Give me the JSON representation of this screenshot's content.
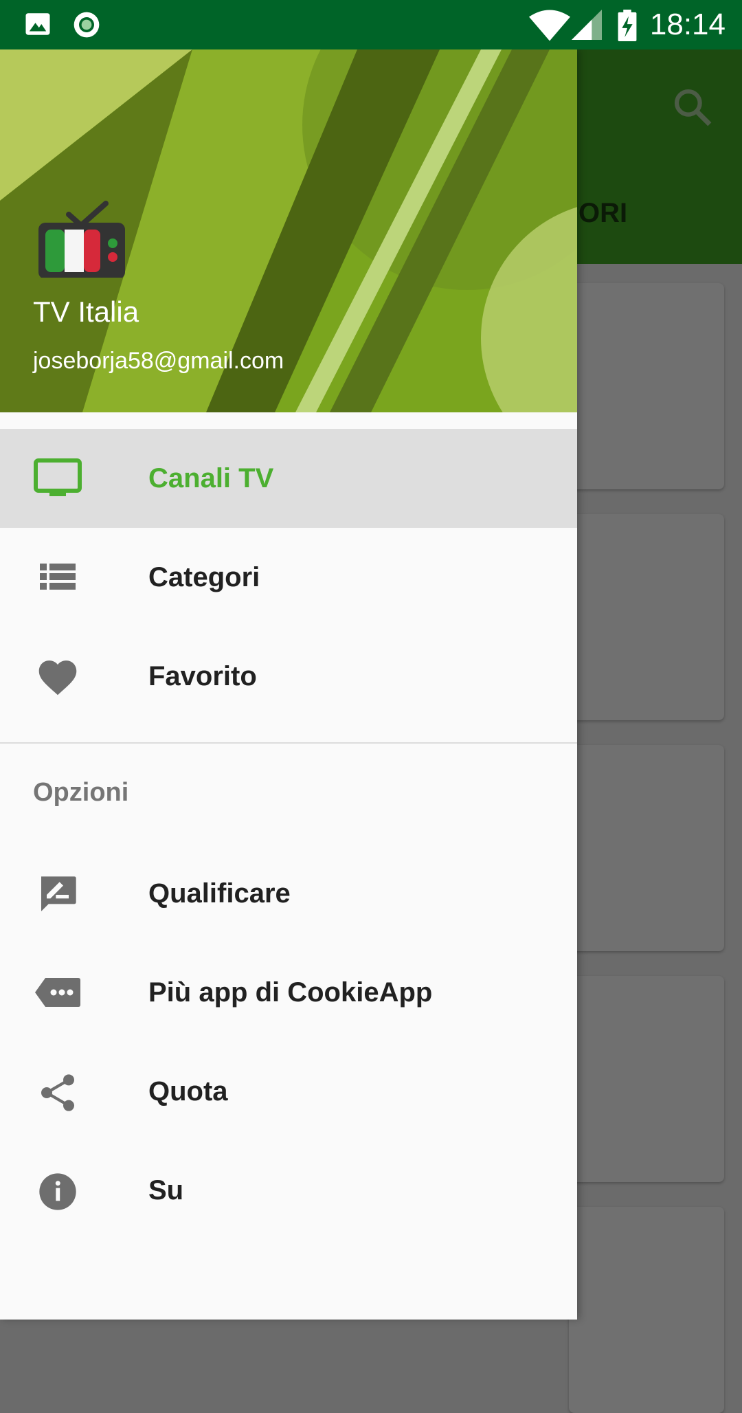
{
  "status_bar": {
    "time": "18:14",
    "icons": [
      "image-icon",
      "record-icon",
      "wifi-icon",
      "signal-icon",
      "battery-charging-icon"
    ]
  },
  "background_app": {
    "tab_label_partial": "ORI",
    "icons": [
      "search-icon"
    ]
  },
  "drawer": {
    "header": {
      "app_name": "TV Italia",
      "email": "joseborja58@gmail.com",
      "logo": "tv-italia-logo"
    },
    "items": [
      {
        "label": "Canali TV",
        "icon": "tv-icon",
        "active": true
      },
      {
        "label": "Categori",
        "icon": "list-icon",
        "active": false
      },
      {
        "label": "Favorito",
        "icon": "heart-icon",
        "active": false
      }
    ],
    "section_title": "Opzioni",
    "options": [
      {
        "label": "Qualificare",
        "icon": "rate-review-icon"
      },
      {
        "label": "Più app di CookieApp",
        "icon": "more-apps-icon"
      },
      {
        "label": "Quota",
        "icon": "share-icon"
      },
      {
        "label": "Su",
        "icon": "info-icon"
      }
    ]
  },
  "colors": {
    "status_bar": "#006428",
    "accent": "#4caf30",
    "active_item_bg": "#dedede",
    "drawer_bg": "#fafafa"
  }
}
